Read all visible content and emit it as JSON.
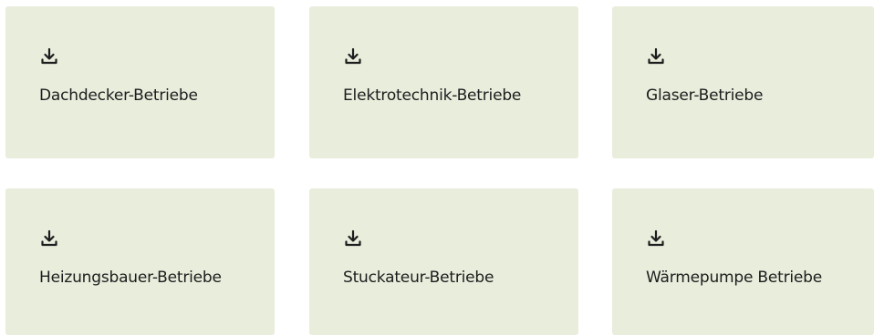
{
  "cards": [
    {
      "label": "Dachdecker-Betriebe",
      "icon": "download-icon"
    },
    {
      "label": "Elektrotechnik-Betriebe",
      "icon": "download-icon"
    },
    {
      "label": "Glaser-Betriebe",
      "icon": "download-icon"
    },
    {
      "label": "Heizungsbauer-Betriebe",
      "icon": "download-icon"
    },
    {
      "label": "Stuckateur-Betriebe",
      "icon": "download-icon"
    },
    {
      "label": "Wärmepumpe Betriebe",
      "icon": "download-icon"
    }
  ],
  "colors": {
    "card_background": "#e8eddc",
    "text": "#1d1d1d",
    "icon": "#1d1d1d"
  }
}
